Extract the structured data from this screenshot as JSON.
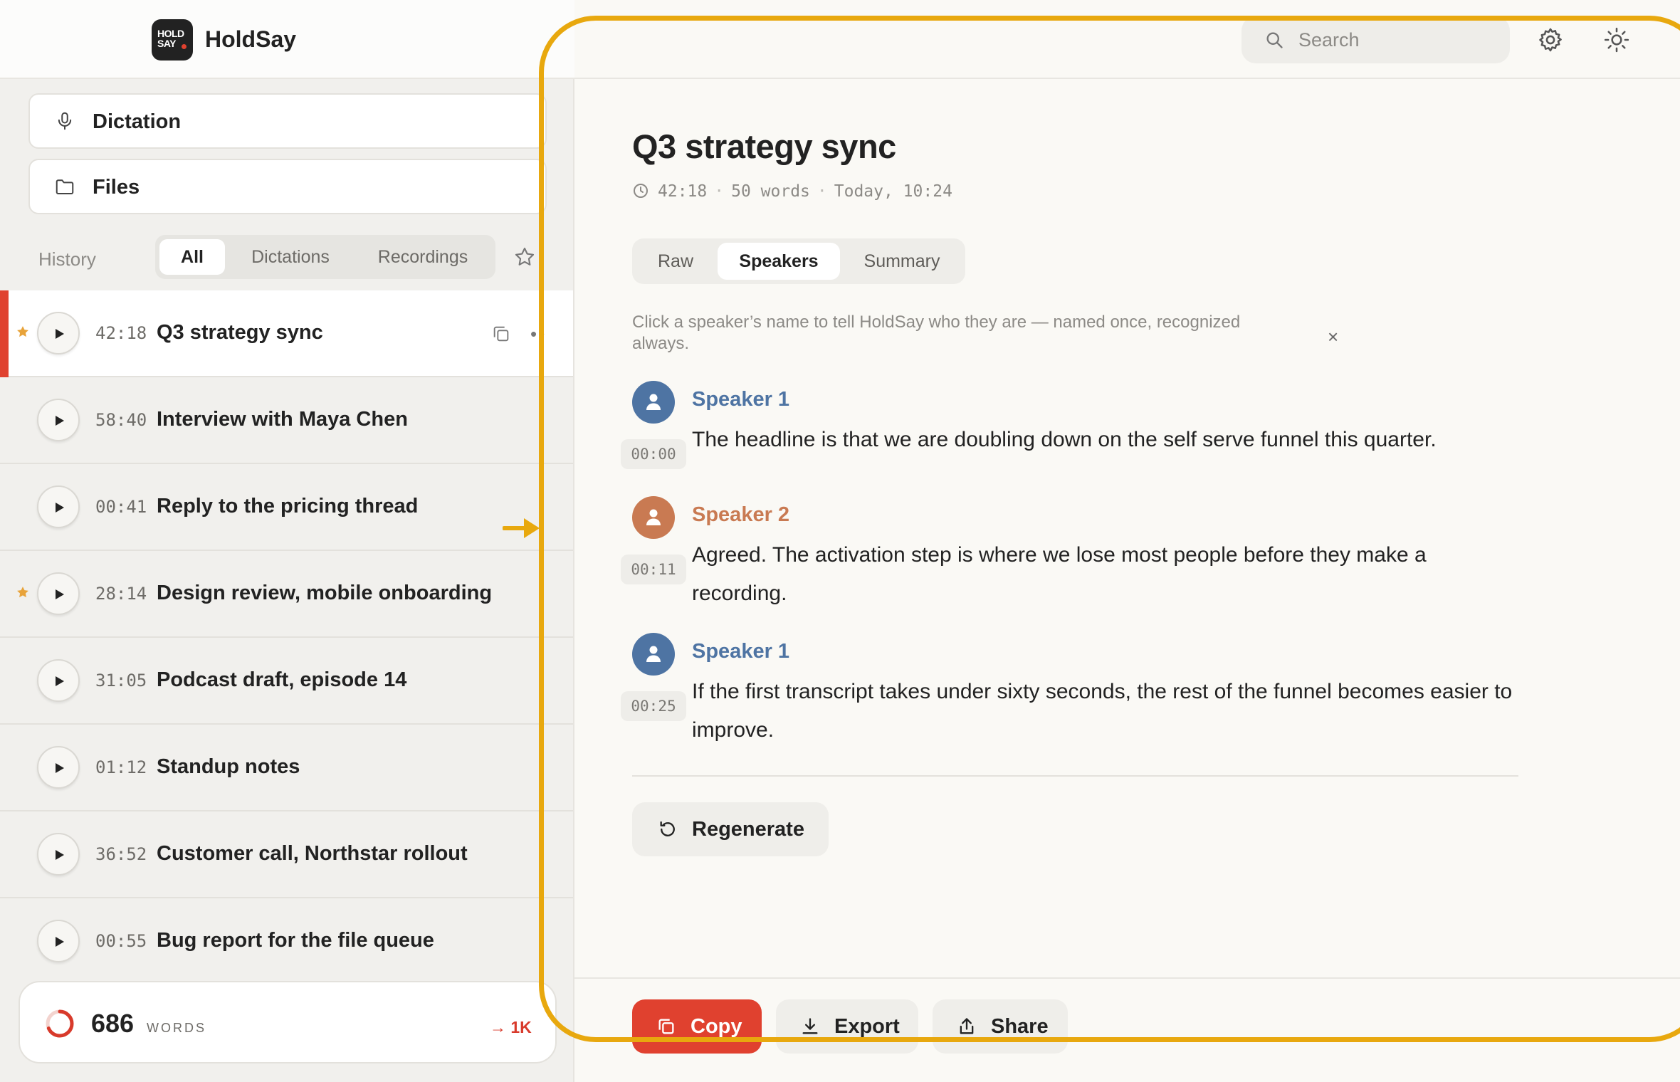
{
  "app": {
    "name": "HoldSay",
    "logo_text": "HOLD SAY"
  },
  "sidebar": {
    "nav": [
      {
        "label": "Dictation",
        "icon": "microphone-icon"
      },
      {
        "label": "Files",
        "icon": "folder-icon"
      }
    ],
    "history_label": "History",
    "filters": [
      "All",
      "Dictations",
      "Recordings"
    ],
    "active_filter": "All",
    "items": [
      {
        "duration": "42:18",
        "title": "Q3 strategy sync",
        "starred": true,
        "active": true
      },
      {
        "duration": "58:40",
        "title": "Interview with Maya Chen",
        "starred": false
      },
      {
        "duration": "00:41",
        "title": "Reply to the pricing thread",
        "starred": false
      },
      {
        "duration": "28:14",
        "title": "Design review, mobile onboarding",
        "starred": true
      },
      {
        "duration": "31:05",
        "title": "Podcast draft, episode 14",
        "starred": false
      },
      {
        "duration": "01:12",
        "title": "Standup notes",
        "starred": false
      },
      {
        "duration": "36:52",
        "title": "Customer call, Northstar rollout",
        "starred": false
      },
      {
        "duration": "00:55",
        "title": "Bug report for the file queue",
        "starred": false
      }
    ],
    "words": {
      "count": "686",
      "unit": "WORDS",
      "goal": "→ 1K",
      "progress": 0.686
    }
  },
  "topbar": {
    "search_placeholder": "Search"
  },
  "document": {
    "title": "Q3 strategy sync",
    "meta": {
      "duration": "42:18",
      "words": "50 words",
      "date": "Today, 10:24",
      "separator": "·"
    },
    "tabs": [
      "Raw",
      "Speakers",
      "Summary"
    ],
    "active_tab": "Speakers",
    "hint": "Click a speaker’s name to tell HoldSay who they are — named once, recognized always.",
    "hint_close": "×",
    "turns": [
      {
        "speaker": "Speaker 1",
        "time": "00:00",
        "text": "The headline is that we are doubling down on the self serve funnel this quarter.",
        "color": "#4e74a3"
      },
      {
        "speaker": "Speaker 2",
        "time": "00:11",
        "text": "Agreed. The activation step is where we lose most people before they make a recording.",
        "color": "#c97a52"
      },
      {
        "speaker": "Speaker 1",
        "time": "00:25",
        "text": "If the first transcript takes under sixty seconds, the rest of the funnel becomes easier to improve.",
        "color": "#4e74a3"
      }
    ],
    "regenerate_label": "Regenerate"
  },
  "footer": {
    "copy_label": "Copy",
    "export_label": "Export",
    "share_label": "Share"
  },
  "colors": {
    "accent": "#e0412f",
    "highlight": "#e8a80e",
    "star": "#e8a33a",
    "speaker_1": "#4e74a3",
    "speaker_2": "#c97a52"
  }
}
